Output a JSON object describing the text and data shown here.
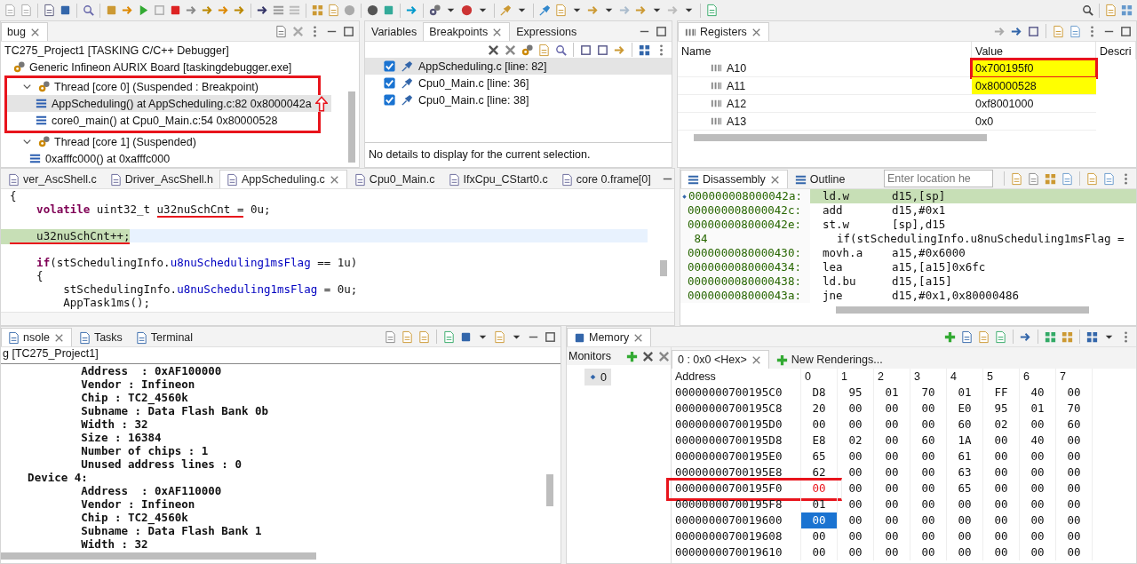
{
  "debug": {
    "tabs": [
      {
        "label": "bug",
        "selected": true
      }
    ],
    "tree": [
      {
        "label": "TC275_Project1 [TASKING C/C++ Debugger]",
        "kind": "launch",
        "children": [
          {
            "label": "Generic Infineon AURIX Board [taskingdebugger.exe]",
            "kind": "process",
            "children": [
              {
                "label": "Thread [core 0] (Suspended : Breakpoint)",
                "kind": "thread",
                "expanded": true,
                "highlighted": true,
                "children": [
                  {
                    "label": "AppScheduling() at AppScheduling.c:82 0x8000042a",
                    "kind": "frame",
                    "selected": true,
                    "arrow_mark": true
                  },
                  {
                    "label": "core0_main() at Cpu0_Main.c:54 0x80000528",
                    "kind": "frame",
                    "selected": false,
                    "arrow_mark": false
                  }
                ]
              },
              {
                "label": "Thread [core 1] (Suspended)",
                "kind": "thread",
                "expanded": true,
                "highlighted": false,
                "children": [
                  {
                    "label": "0xafffc000() at 0xafffc000",
                    "kind": "frame",
                    "selected": false,
                    "arrow_mark": false
                  }
                ]
              }
            ]
          }
        ]
      }
    ]
  },
  "breakpoints": {
    "tabs": [
      {
        "label": "Variables",
        "selected": false
      },
      {
        "label": "Breakpoints",
        "selected": true
      },
      {
        "label": "Expressions",
        "selected": false
      }
    ],
    "items": [
      {
        "label": "AppScheduling.c [line: 82]",
        "checked": true,
        "selected": true
      },
      {
        "label": "Cpu0_Main.c [line: 36]",
        "checked": true,
        "selected": false
      },
      {
        "label": "Cpu0_Main.c [line: 38]",
        "checked": true,
        "selected": false
      }
    ],
    "details": "No details to display for the current selection."
  },
  "registers": {
    "tabs": [
      {
        "label": "Registers",
        "selected": true
      }
    ],
    "columns": [
      "Name",
      "Value",
      "Descri"
    ],
    "rows": [
      {
        "name": "A10",
        "value": "0x700195f0",
        "changed": true,
        "highlighted": true
      },
      {
        "name": "A11",
        "value": "0x80000528",
        "changed": true,
        "highlighted": false
      },
      {
        "name": "A12",
        "value": "0xf8001000",
        "changed": false,
        "highlighted": false
      },
      {
        "name": "A13",
        "value": "0x0",
        "changed": false,
        "highlighted": false
      }
    ]
  },
  "editor": {
    "tabs": [
      {
        "label": "ver_AscShell.c",
        "selected": false
      },
      {
        "label": "Driver_AscShell.h",
        "selected": false
      },
      {
        "label": "AppScheduling.c",
        "selected": true
      },
      {
        "label": "Cpu0_Main.c",
        "selected": false
      },
      {
        "label": "IfxCpu_CStart0.c",
        "selected": false
      },
      {
        "label": "core 0.frame[0]",
        "selected": false
      }
    ],
    "lines": [
      {
        "current": false,
        "segments": [
          {
            "text": "{",
            "kind": "plain",
            "underlined": false
          }
        ]
      },
      {
        "current": false,
        "segments": [
          {
            "text": "    volatile",
            "kind": "keyword",
            "underlined": false
          },
          {
            "text": " uint32_t ",
            "kind": "plain",
            "underlined": false
          },
          {
            "text": "u32nuSchCnt =",
            "kind": "plain",
            "underlined": true
          },
          {
            "text": " 0u;",
            "kind": "plain",
            "underlined": false
          }
        ]
      },
      {
        "current": false
      },
      {
        "current": true,
        "segments": [
          {
            "text": "    u32nuSchCnt++;",
            "kind": "plain",
            "underlined": true
          }
        ]
      },
      {
        "current": false
      },
      {
        "current": false,
        "segments": [
          {
            "text": "    if",
            "kind": "keyword",
            "underlined": false
          },
          {
            "text": "(stSchedulingInfo.",
            "kind": "plain",
            "underlined": false
          },
          {
            "text": "u8nuScheduling1msFlag",
            "kind": "field",
            "underlined": false
          },
          {
            "text": " == 1u)",
            "kind": "plain",
            "underlined": false
          }
        ]
      },
      {
        "current": false,
        "segments": [
          {
            "text": "    {",
            "kind": "plain",
            "underlined": false
          }
        ]
      },
      {
        "current": false,
        "segments": [
          {
            "text": "        stSchedulingInfo.",
            "kind": "plain",
            "underlined": false
          },
          {
            "text": "u8nuScheduling1msFlag",
            "kind": "field",
            "underlined": false
          },
          {
            "text": " = 0u;",
            "kind": "plain",
            "underlined": false
          }
        ]
      },
      {
        "current": false,
        "segments": [
          {
            "text": "        AppTask1ms();",
            "kind": "plain",
            "underlined": false
          }
        ]
      }
    ]
  },
  "disassembly": {
    "tabs": [
      {
        "label": "Disassembly",
        "selected": true
      },
      {
        "label": "Outline",
        "selected": false
      }
    ],
    "location": {
      "placeholder": "Enter location he"
    },
    "rows": [
      {
        "kind": "instruction",
        "address": "000000008000042a:",
        "mnemonic": "ld.w",
        "operands": "d15,[sp]",
        "current": true
      },
      {
        "kind": "instruction",
        "address": "000000008000042c:",
        "mnemonic": "add",
        "operands": "d15,#0x1",
        "current": false
      },
      {
        "kind": "instruction",
        "address": "000000008000042e:",
        "mnemonic": "st.w",
        "operands": "[sp],d15",
        "current": false
      },
      {
        "kind": "source",
        "line": "84",
        "text": "if(stSchedulingInfo.u8nuScheduling1msFlag ="
      },
      {
        "kind": "instruction",
        "address": "0000000080000430:",
        "mnemonic": "movh.a",
        "operands": "a15,#0x6000",
        "current": false
      },
      {
        "kind": "instruction",
        "address": "0000000080000434:",
        "mnemonic": "lea",
        "operands": "a15,[a15]0x6fc",
        "current": false
      },
      {
        "kind": "instruction",
        "address": "0000000080000438:",
        "mnemonic": "ld.bu",
        "operands": "d15,[a15]",
        "current": false
      },
      {
        "kind": "instruction",
        "address": "000000008000043a:",
        "mnemonic": "jne",
        "operands": "d15,#0x1,0x80000486",
        "current": false
      }
    ]
  },
  "console": {
    "tabs": [
      {
        "label": "nsole",
        "selected": true
      },
      {
        "label": "Tasks",
        "selected": false
      },
      {
        "label": "Terminal",
        "selected": false
      }
    ],
    "title": "g [TC275_Project1]",
    "lines": [
      "            Address  : 0xAF100000",
      "            Vendor : Infineon",
      "            Chip : TC2_4560k",
      "            Subname : Data Flash Bank 0b",
      "            Width : 32",
      "            Size : 16384",
      "            Number of chips : 1",
      "            Unused address lines : 0",
      "    Device 4:",
      "            Address  : 0xAF110000",
      "            Vendor : Infineon",
      "            Chip : TC2_4560k",
      "            Subname : Data Flash Bank 1",
      "            Width : 32"
    ]
  },
  "memory": {
    "tabs": [
      {
        "label": "Memory",
        "selected": true
      }
    ],
    "monitors": {
      "title": "Monitors",
      "items": [
        {
          "label": "0",
          "selected": true
        }
      ]
    },
    "renderings": [
      {
        "label": "0 : 0x0  <Hex>",
        "selected": true
      },
      {
        "label": "New Renderings...",
        "selected": false
      }
    ],
    "columns": [
      "Address",
      "0",
      "1",
      "2",
      "3",
      "4",
      "5",
      "6",
      "7"
    ],
    "rows": [
      {
        "address": "00000000700195C0",
        "highlighted": false,
        "cells": [
          {
            "value": "D8",
            "changed": false,
            "selected": false
          },
          {
            "value": "95",
            "changed": false,
            "selected": false
          },
          {
            "value": "01",
            "changed": false,
            "selected": false
          },
          {
            "value": "70",
            "changed": false,
            "selected": false
          },
          {
            "value": "01",
            "changed": false,
            "selected": false
          },
          {
            "value": "FF",
            "changed": false,
            "selected": false
          },
          {
            "value": "40",
            "changed": false,
            "selected": false
          },
          {
            "value": "00",
            "changed": false,
            "selected": false
          }
        ]
      },
      {
        "address": "00000000700195C8",
        "highlighted": false,
        "cells": [
          {
            "value": "20",
            "changed": false,
            "selected": false
          },
          {
            "value": "00",
            "changed": false,
            "selected": false
          },
          {
            "value": "00",
            "changed": false,
            "selected": false
          },
          {
            "value": "00",
            "changed": false,
            "selected": false
          },
          {
            "value": "E0",
            "changed": false,
            "selected": false
          },
          {
            "value": "95",
            "changed": false,
            "selected": false
          },
          {
            "value": "01",
            "changed": false,
            "selected": false
          },
          {
            "value": "70",
            "changed": false,
            "selected": false
          }
        ]
      },
      {
        "address": "00000000700195D0",
        "highlighted": false,
        "cells": [
          {
            "value": "00",
            "changed": false,
            "selected": false
          },
          {
            "value": "00",
            "changed": false,
            "selected": false
          },
          {
            "value": "00",
            "changed": false,
            "selected": false
          },
          {
            "value": "00",
            "changed": false,
            "selected": false
          },
          {
            "value": "60",
            "changed": false,
            "selected": false
          },
          {
            "value": "02",
            "changed": false,
            "selected": false
          },
          {
            "value": "00",
            "changed": false,
            "selected": false
          },
          {
            "value": "60",
            "changed": false,
            "selected": false
          }
        ]
      },
      {
        "address": "00000000700195D8",
        "highlighted": false,
        "cells": [
          {
            "value": "E8",
            "changed": false,
            "selected": false
          },
          {
            "value": "02",
            "changed": false,
            "selected": false
          },
          {
            "value": "00",
            "changed": false,
            "selected": false
          },
          {
            "value": "60",
            "changed": false,
            "selected": false
          },
          {
            "value": "1A",
            "changed": false,
            "selected": false
          },
          {
            "value": "00",
            "changed": false,
            "selected": false
          },
          {
            "value": "40",
            "changed": false,
            "selected": false
          },
          {
            "value": "00",
            "changed": false,
            "selected": false
          }
        ]
      },
      {
        "address": "00000000700195E0",
        "highlighted": false,
        "cells": [
          {
            "value": "65",
            "changed": false,
            "selected": false
          },
          {
            "value": "00",
            "changed": false,
            "selected": false
          },
          {
            "value": "00",
            "changed": false,
            "selected": false
          },
          {
            "value": "00",
            "changed": false,
            "selected": false
          },
          {
            "value": "61",
            "changed": false,
            "selected": false
          },
          {
            "value": "00",
            "changed": false,
            "selected": false
          },
          {
            "value": "00",
            "changed": false,
            "selected": false
          },
          {
            "value": "00",
            "changed": false,
            "selected": false
          }
        ]
      },
      {
        "address": "00000000700195E8",
        "highlighted": false,
        "cells": [
          {
            "value": "62",
            "changed": false,
            "selected": false
          },
          {
            "value": "00",
            "changed": false,
            "selected": false
          },
          {
            "value": "00",
            "changed": false,
            "selected": false
          },
          {
            "value": "00",
            "changed": false,
            "selected": false
          },
          {
            "value": "63",
            "changed": false,
            "selected": false
          },
          {
            "value": "00",
            "changed": false,
            "selected": false
          },
          {
            "value": "00",
            "changed": false,
            "selected": false
          },
          {
            "value": "00",
            "changed": false,
            "selected": false
          }
        ]
      },
      {
        "address": "00000000700195F0",
        "highlighted": true,
        "cells": [
          {
            "value": "00",
            "changed": true,
            "selected": false
          },
          {
            "value": "00",
            "changed": false,
            "selected": false
          },
          {
            "value": "00",
            "changed": false,
            "selected": false
          },
          {
            "value": "00",
            "changed": false,
            "selected": false
          },
          {
            "value": "65",
            "changed": false,
            "selected": false
          },
          {
            "value": "00",
            "changed": false,
            "selected": false
          },
          {
            "value": "00",
            "changed": false,
            "selected": false
          },
          {
            "value": "00",
            "changed": false,
            "selected": false
          }
        ]
      },
      {
        "address": "00000000700195F8",
        "highlighted": false,
        "cells": [
          {
            "value": "01",
            "changed": false,
            "selected": false
          },
          {
            "value": "00",
            "changed": false,
            "selected": false
          },
          {
            "value": "00",
            "changed": false,
            "selected": false
          },
          {
            "value": "00",
            "changed": false,
            "selected": false
          },
          {
            "value": "00",
            "changed": false,
            "selected": false
          },
          {
            "value": "00",
            "changed": false,
            "selected": false
          },
          {
            "value": "00",
            "changed": false,
            "selected": false
          },
          {
            "value": "00",
            "changed": false,
            "selected": false
          }
        ]
      },
      {
        "address": "0000000070019600",
        "highlighted": false,
        "cells": [
          {
            "value": "00",
            "changed": false,
            "selected": true
          },
          {
            "value": "00",
            "changed": false,
            "selected": false
          },
          {
            "value": "00",
            "changed": false,
            "selected": false
          },
          {
            "value": "00",
            "changed": false,
            "selected": false
          },
          {
            "value": "00",
            "changed": false,
            "selected": false
          },
          {
            "value": "00",
            "changed": false,
            "selected": false
          },
          {
            "value": "00",
            "changed": false,
            "selected": false
          },
          {
            "value": "00",
            "changed": false,
            "selected": false
          }
        ]
      },
      {
        "address": "0000000070019608",
        "highlighted": false,
        "cells": [
          {
            "value": "00",
            "changed": false,
            "selected": false
          },
          {
            "value": "00",
            "changed": false,
            "selected": false
          },
          {
            "value": "00",
            "changed": false,
            "selected": false
          },
          {
            "value": "00",
            "changed": false,
            "selected": false
          },
          {
            "value": "00",
            "changed": false,
            "selected": false
          },
          {
            "value": "00",
            "changed": false,
            "selected": false
          },
          {
            "value": "00",
            "changed": false,
            "selected": false
          },
          {
            "value": "00",
            "changed": false,
            "selected": false
          }
        ]
      },
      {
        "address": "0000000070019610",
        "highlighted": false,
        "cells": [
          {
            "value": "00",
            "changed": false,
            "selected": false
          },
          {
            "value": "00",
            "changed": false,
            "selected": false
          },
          {
            "value": "00",
            "changed": false,
            "selected": false
          },
          {
            "value": "00",
            "changed": false,
            "selected": false
          },
          {
            "value": "00",
            "changed": false,
            "selected": false
          },
          {
            "value": "00",
            "changed": false,
            "selected": false
          },
          {
            "value": "00",
            "changed": false,
            "selected": false
          },
          {
            "value": "00",
            "changed": false,
            "selected": false
          }
        ]
      }
    ]
  }
}
